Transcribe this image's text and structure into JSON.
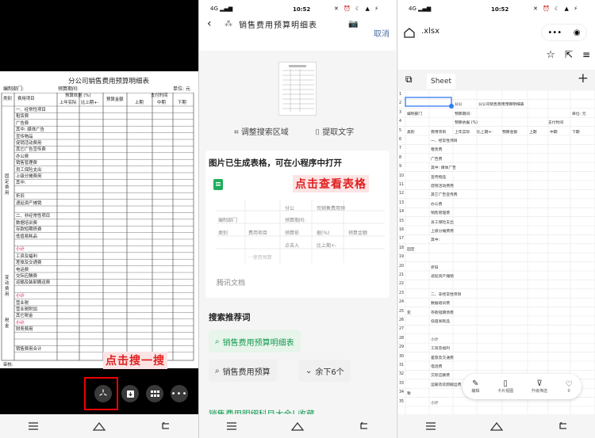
{
  "panel1": {
    "doc_title": "分公司销售费用预算明细表",
    "dept_label": "编制部门:",
    "period_label": "预算期间:",
    "unit_label": "单位: 元",
    "headers": {
      "type": "类别",
      "item": "费用项目",
      "basis": "预算依据 (%)",
      "prior": "上年实际",
      "ratio": "比上期+-",
      "amount": "预算金额",
      "paytime": "支付时间",
      "q1": "上期",
      "q2": "中期",
      "q3": "下期"
    },
    "rows": [
      "一、经常性项目",
      "租赁费",
      "广告费",
      "其中: 媒体广告",
      "宣传物品",
      "促销活动费用",
      "其它广告宣传费",
      "办公费",
      "销售管理费",
      "员工保险支出",
      "上级分摊费用",
      "其中:",
      "",
      "折旧",
      "递延资产摊销",
      "",
      "二、非经常性项目",
      "数据培训费",
      "存款短期债费",
      "低值易耗品",
      "",
      "小计",
      "工资及福利",
      "差旅及交通费",
      "电话费",
      "交际应酬费",
      "运输及装卸搬运费",
      "",
      "小计",
      "营业税",
      "营业税附加",
      "其它税金",
      "小计",
      "  财务费用",
      "",
      "",
      "销售费用合计"
    ],
    "side_labels": [
      "固定费用",
      "变动费用",
      "税金"
    ],
    "footer": "审核:",
    "callout": "点击搜一搜",
    "circle_labels": [
      "⋮"
    ]
  },
  "panel2": {
    "status_time": "10:52",
    "search_text": "销售费用预算明细表",
    "cancel": "取消",
    "tool_adjust": "调整搜索区域",
    "tool_extract": "提取文字",
    "card_title": "图片已生成表格，可在小程序中打开",
    "callout": "点击查看表格",
    "mini_cells": [
      "分公",
      "司销售费用预",
      "编制部门",
      "预算期间:",
      "类别",
      "费用项目",
      "预算依",
      "据(%)",
      "预算金额",
      "点击入",
      "比上期+-",
      "···使用预算"
    ],
    "source": "腾讯文档",
    "recommend_title": "搜索推荐词",
    "chip1": "销售费用预算明细表",
    "chip2": "销售费用预算",
    "chip3": "余下6个",
    "bottom_link": "销售费用明细科目大全! 收藏"
  },
  "panel3": {
    "status_time": "10:52",
    "file_name": ".xlsx",
    "sheet_tab": "Sheet",
    "cells": [
      [
        "1",
        "",
        ""
      ],
      [
        "2",
        "分公",
        "",
        ""
      ],
      [
        "3",
        "编制部门",
        "预算期间:"
      ],
      [
        "4",
        "类别",
        "费用项目"
      ],
      [
        "5",
        "一、经常性项目"
      ],
      [
        "6",
        "租赁费"
      ],
      [
        "7",
        "广告费"
      ],
      [
        "8",
        "其中: 媒体广告"
      ],
      [
        "9",
        "宣传物品"
      ],
      [
        "10",
        "促销活动费用"
      ],
      [
        "11",
        "其它广告宣传费"
      ],
      [
        "12",
        "办公费"
      ],
      [
        "13",
        "销售管理费"
      ],
      [
        "14",
        "员工保险支出"
      ],
      [
        "15",
        "上级分摊费用"
      ],
      [
        "16",
        "其中:"
      ],
      [
        "17",
        ""
      ],
      [
        "18",
        ""
      ],
      [
        "19",
        "折旧"
      ],
      [
        "20",
        "递延资产摊销"
      ]
    ],
    "header_cells": {
      "title": "分公司销售费用预算明细表",
      "unit": "单位: 元",
      "basis": "预算依据 (%)",
      "amount": "预算金额",
      "paytime": "支付时间",
      "prior": "上年实际",
      "ratio": "比上期+-",
      "q1": "上期",
      "q2": "中期",
      "q3": "下期",
      "fixed": "固定",
      "change": "变",
      "tax": "税"
    },
    "more_rows": [
      "二、非经常性项目",
      "数据培训费",
      "存款短期债费",
      "低值易耗品",
      "",
      "小计",
      "工资及福利",
      "差旅及交通费",
      "电话费",
      "交际应酬费",
      "运输及装卸搬运费",
      "",
      "小计"
    ],
    "toolbar": {
      "edit": "编辑",
      "card": "卡片视图",
      "filter": "升级筛选",
      "like": "0"
    }
  }
}
